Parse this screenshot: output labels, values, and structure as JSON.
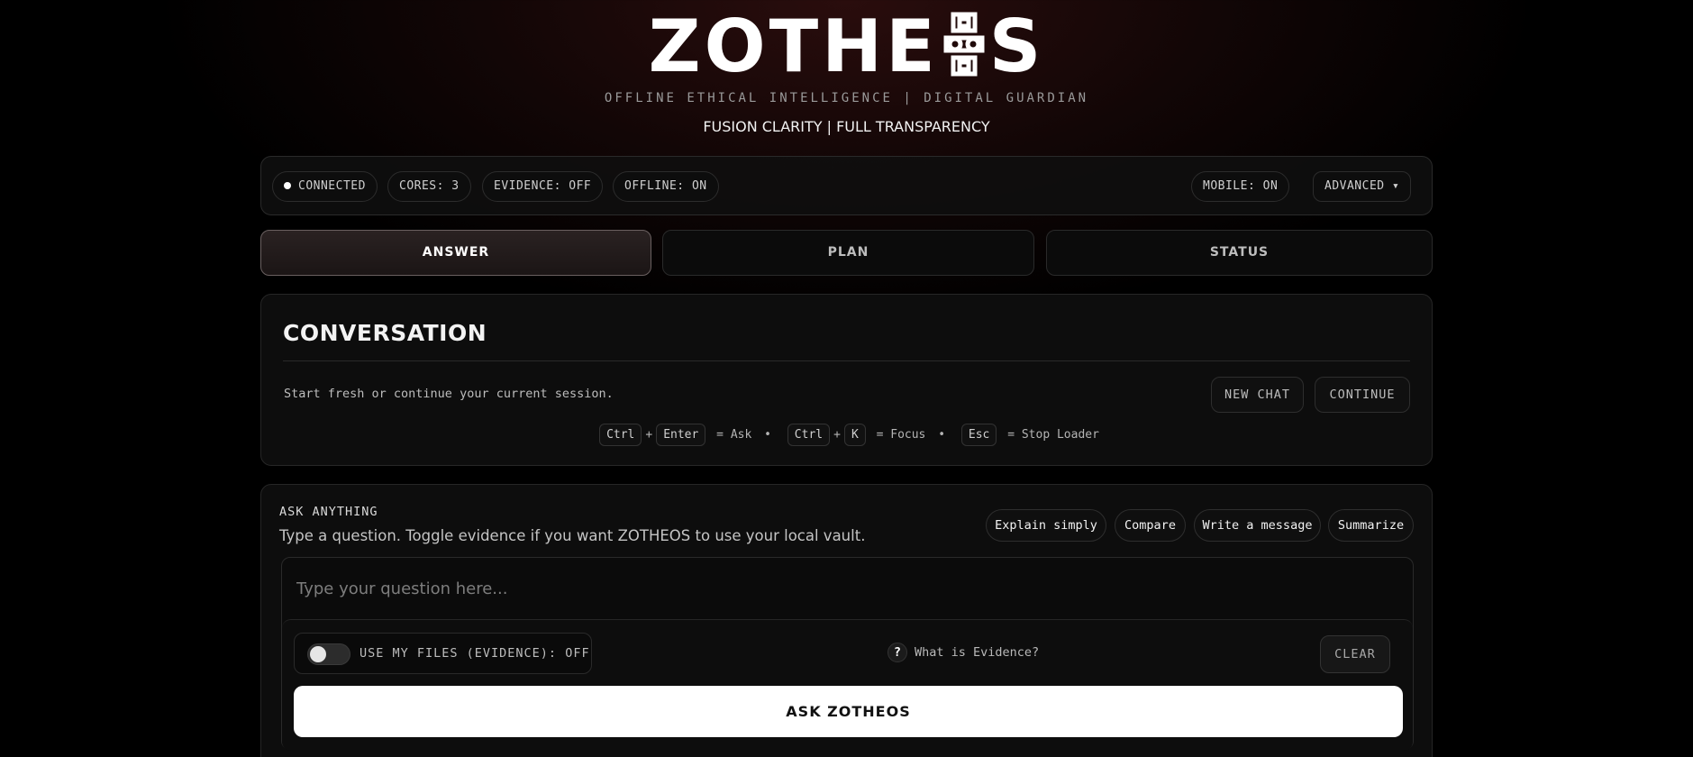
{
  "header": {
    "logo_left": "ZOTHE",
    "logo_right": "S",
    "logo_glyph": "shield-knot-o-glyph",
    "tagline": "OFFLINE ETHICAL INTELLIGENCE | DIGITAL GUARDIAN",
    "subtagline": "FUSION CLARITY | FULL TRANSPARENCY"
  },
  "status": {
    "connected": "CONNECTED",
    "cores": "CORES: 3",
    "evidence": "EVIDENCE: OFF",
    "offline": "OFFLINE: ON",
    "mobile": "MOBILE: ON",
    "advanced": "ADVANCED ▾"
  },
  "tabs": [
    {
      "label": "ANSWER",
      "active": true
    },
    {
      "label": "PLAN",
      "active": false
    },
    {
      "label": "STATUS",
      "active": false
    }
  ],
  "conversation": {
    "title": "CONVERSATION",
    "description": "Start fresh or continue your current session.",
    "new_chat": "NEW CHAT",
    "continue": "CONTINUE",
    "shortcuts": {
      "ctrl": "Ctrl",
      "plus": "+",
      "enter": "Enter",
      "ask": "= Ask",
      "sep": "•",
      "k": "K",
      "focus": "= Focus",
      "esc": "Esc",
      "stop": "= Stop Loader"
    }
  },
  "ask": {
    "label": "ASK ANYTHING",
    "description": "Type a question. Toggle evidence if you want ZOTHEOS to use your local vault.",
    "chips": [
      "Explain simply",
      "Compare",
      "Write a message",
      "Summarize"
    ],
    "placeholder": "Type your question here...",
    "toggle_label": "USE MY FILES (EVIDENCE): OFF",
    "help_q": "?",
    "help_label": "What is Evidence?",
    "clear": "CLEAR",
    "submit": "ASK ZOTHEOS"
  },
  "colors": {
    "background": "#000000",
    "accent_glow": "#2a0d0d",
    "primary_button": "#ffffff"
  }
}
